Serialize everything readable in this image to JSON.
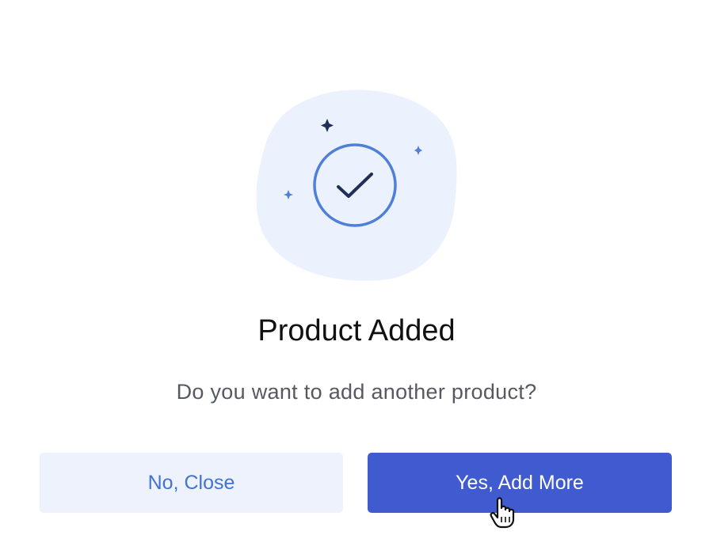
{
  "dialog": {
    "title": "Product Added",
    "message": "Do you want to add another product?",
    "secondary_button_label": "No, Close",
    "primary_button_label": "Yes, Add More",
    "illustration_icon": "check-circle-icon",
    "sparkle_icon": "sparkle-icon",
    "cursor_icon": "hand-pointer-cursor-icon"
  },
  "colors": {
    "primary": "#3f5bcf",
    "secondary_bg": "#edf2fc",
    "secondary_text": "#4273cf",
    "illustration_bg": "#ecf2fd",
    "check_circle": "#4f7fd8",
    "check_mark": "#1f2f57",
    "title_text": "#111111",
    "message_text": "#555a61"
  }
}
